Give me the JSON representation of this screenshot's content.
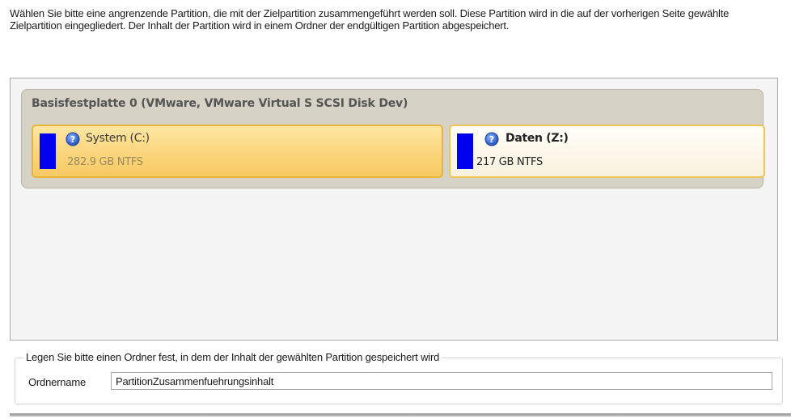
{
  "intro_text": "Wählen Sie bitte eine angrenzende Partition, die mit der Zielpartition zusammengeführt werden soll. Diese Partition wird in die auf der vorherigen Seite gewählte Zielpartition eingegliedert. Der Inhalt der Partition wird in einem Ordner der endgültigen Partition abgespeichert.",
  "disk": {
    "title": "Basisfestplatte 0 (VMware, VMware Virtual S SCSI Disk Dev)",
    "partitions": [
      {
        "name": "System (C:)",
        "size": "282.9 GB NTFS",
        "icon": "help-icon",
        "selected": true
      },
      {
        "name": "Daten (Z:)",
        "size": "217 GB NTFS",
        "icon": "help-icon",
        "selected": false
      }
    ]
  },
  "folder": {
    "legend": "Legen Sie bitte einen Ordner fest, in dem der Inhalt der gewählten Partition gespeichert wird",
    "label": "Ordnername",
    "value": "PartitionZusammenfuehrungsinhalt"
  },
  "colors": {
    "partition_bar": "#0000ee",
    "selected_fill": "#fbd57c",
    "border_accent": "#efc451"
  }
}
